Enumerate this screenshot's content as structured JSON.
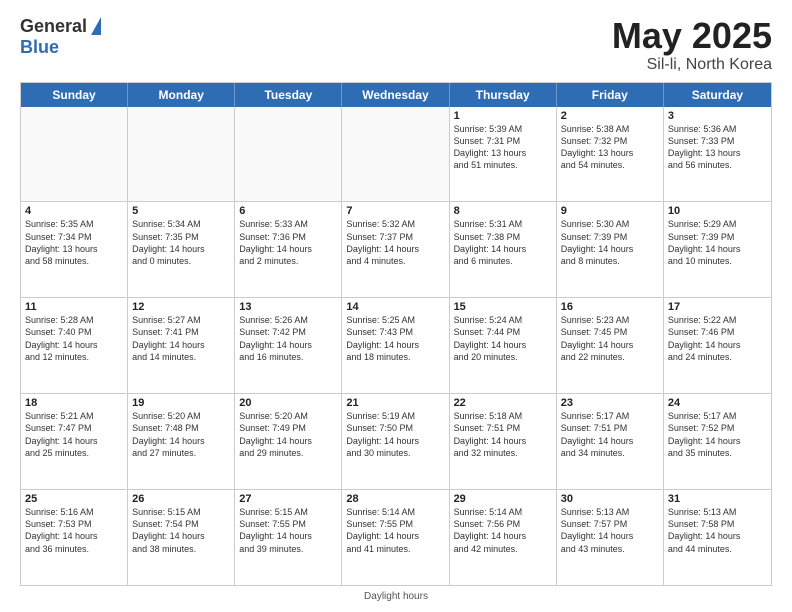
{
  "logo": {
    "general": "General",
    "blue": "Blue"
  },
  "title": {
    "month": "May 2025",
    "location": "Sil-li, North Korea"
  },
  "header_days": [
    "Sunday",
    "Monday",
    "Tuesday",
    "Wednesday",
    "Thursday",
    "Friday",
    "Saturday"
  ],
  "footer": "Daylight hours",
  "weeks": [
    [
      {
        "day": "",
        "info": ""
      },
      {
        "day": "",
        "info": ""
      },
      {
        "day": "",
        "info": ""
      },
      {
        "day": "",
        "info": ""
      },
      {
        "day": "1",
        "info": "Sunrise: 5:39 AM\nSunset: 7:31 PM\nDaylight: 13 hours\nand 51 minutes."
      },
      {
        "day": "2",
        "info": "Sunrise: 5:38 AM\nSunset: 7:32 PM\nDaylight: 13 hours\nand 54 minutes."
      },
      {
        "day": "3",
        "info": "Sunrise: 5:36 AM\nSunset: 7:33 PM\nDaylight: 13 hours\nand 56 minutes."
      }
    ],
    [
      {
        "day": "4",
        "info": "Sunrise: 5:35 AM\nSunset: 7:34 PM\nDaylight: 13 hours\nand 58 minutes."
      },
      {
        "day": "5",
        "info": "Sunrise: 5:34 AM\nSunset: 7:35 PM\nDaylight: 14 hours\nand 0 minutes."
      },
      {
        "day": "6",
        "info": "Sunrise: 5:33 AM\nSunset: 7:36 PM\nDaylight: 14 hours\nand 2 minutes."
      },
      {
        "day": "7",
        "info": "Sunrise: 5:32 AM\nSunset: 7:37 PM\nDaylight: 14 hours\nand 4 minutes."
      },
      {
        "day": "8",
        "info": "Sunrise: 5:31 AM\nSunset: 7:38 PM\nDaylight: 14 hours\nand 6 minutes."
      },
      {
        "day": "9",
        "info": "Sunrise: 5:30 AM\nSunset: 7:39 PM\nDaylight: 14 hours\nand 8 minutes."
      },
      {
        "day": "10",
        "info": "Sunrise: 5:29 AM\nSunset: 7:39 PM\nDaylight: 14 hours\nand 10 minutes."
      }
    ],
    [
      {
        "day": "11",
        "info": "Sunrise: 5:28 AM\nSunset: 7:40 PM\nDaylight: 14 hours\nand 12 minutes."
      },
      {
        "day": "12",
        "info": "Sunrise: 5:27 AM\nSunset: 7:41 PM\nDaylight: 14 hours\nand 14 minutes."
      },
      {
        "day": "13",
        "info": "Sunrise: 5:26 AM\nSunset: 7:42 PM\nDaylight: 14 hours\nand 16 minutes."
      },
      {
        "day": "14",
        "info": "Sunrise: 5:25 AM\nSunset: 7:43 PM\nDaylight: 14 hours\nand 18 minutes."
      },
      {
        "day": "15",
        "info": "Sunrise: 5:24 AM\nSunset: 7:44 PM\nDaylight: 14 hours\nand 20 minutes."
      },
      {
        "day": "16",
        "info": "Sunrise: 5:23 AM\nSunset: 7:45 PM\nDaylight: 14 hours\nand 22 minutes."
      },
      {
        "day": "17",
        "info": "Sunrise: 5:22 AM\nSunset: 7:46 PM\nDaylight: 14 hours\nand 24 minutes."
      }
    ],
    [
      {
        "day": "18",
        "info": "Sunrise: 5:21 AM\nSunset: 7:47 PM\nDaylight: 14 hours\nand 25 minutes."
      },
      {
        "day": "19",
        "info": "Sunrise: 5:20 AM\nSunset: 7:48 PM\nDaylight: 14 hours\nand 27 minutes."
      },
      {
        "day": "20",
        "info": "Sunrise: 5:20 AM\nSunset: 7:49 PM\nDaylight: 14 hours\nand 29 minutes."
      },
      {
        "day": "21",
        "info": "Sunrise: 5:19 AM\nSunset: 7:50 PM\nDaylight: 14 hours\nand 30 minutes."
      },
      {
        "day": "22",
        "info": "Sunrise: 5:18 AM\nSunset: 7:51 PM\nDaylight: 14 hours\nand 32 minutes."
      },
      {
        "day": "23",
        "info": "Sunrise: 5:17 AM\nSunset: 7:51 PM\nDaylight: 14 hours\nand 34 minutes."
      },
      {
        "day": "24",
        "info": "Sunrise: 5:17 AM\nSunset: 7:52 PM\nDaylight: 14 hours\nand 35 minutes."
      }
    ],
    [
      {
        "day": "25",
        "info": "Sunrise: 5:16 AM\nSunset: 7:53 PM\nDaylight: 14 hours\nand 36 minutes."
      },
      {
        "day": "26",
        "info": "Sunrise: 5:15 AM\nSunset: 7:54 PM\nDaylight: 14 hours\nand 38 minutes."
      },
      {
        "day": "27",
        "info": "Sunrise: 5:15 AM\nSunset: 7:55 PM\nDaylight: 14 hours\nand 39 minutes."
      },
      {
        "day": "28",
        "info": "Sunrise: 5:14 AM\nSunset: 7:55 PM\nDaylight: 14 hours\nand 41 minutes."
      },
      {
        "day": "29",
        "info": "Sunrise: 5:14 AM\nSunset: 7:56 PM\nDaylight: 14 hours\nand 42 minutes."
      },
      {
        "day": "30",
        "info": "Sunrise: 5:13 AM\nSunset: 7:57 PM\nDaylight: 14 hours\nand 43 minutes."
      },
      {
        "day": "31",
        "info": "Sunrise: 5:13 AM\nSunset: 7:58 PM\nDaylight: 14 hours\nand 44 minutes."
      }
    ]
  ]
}
